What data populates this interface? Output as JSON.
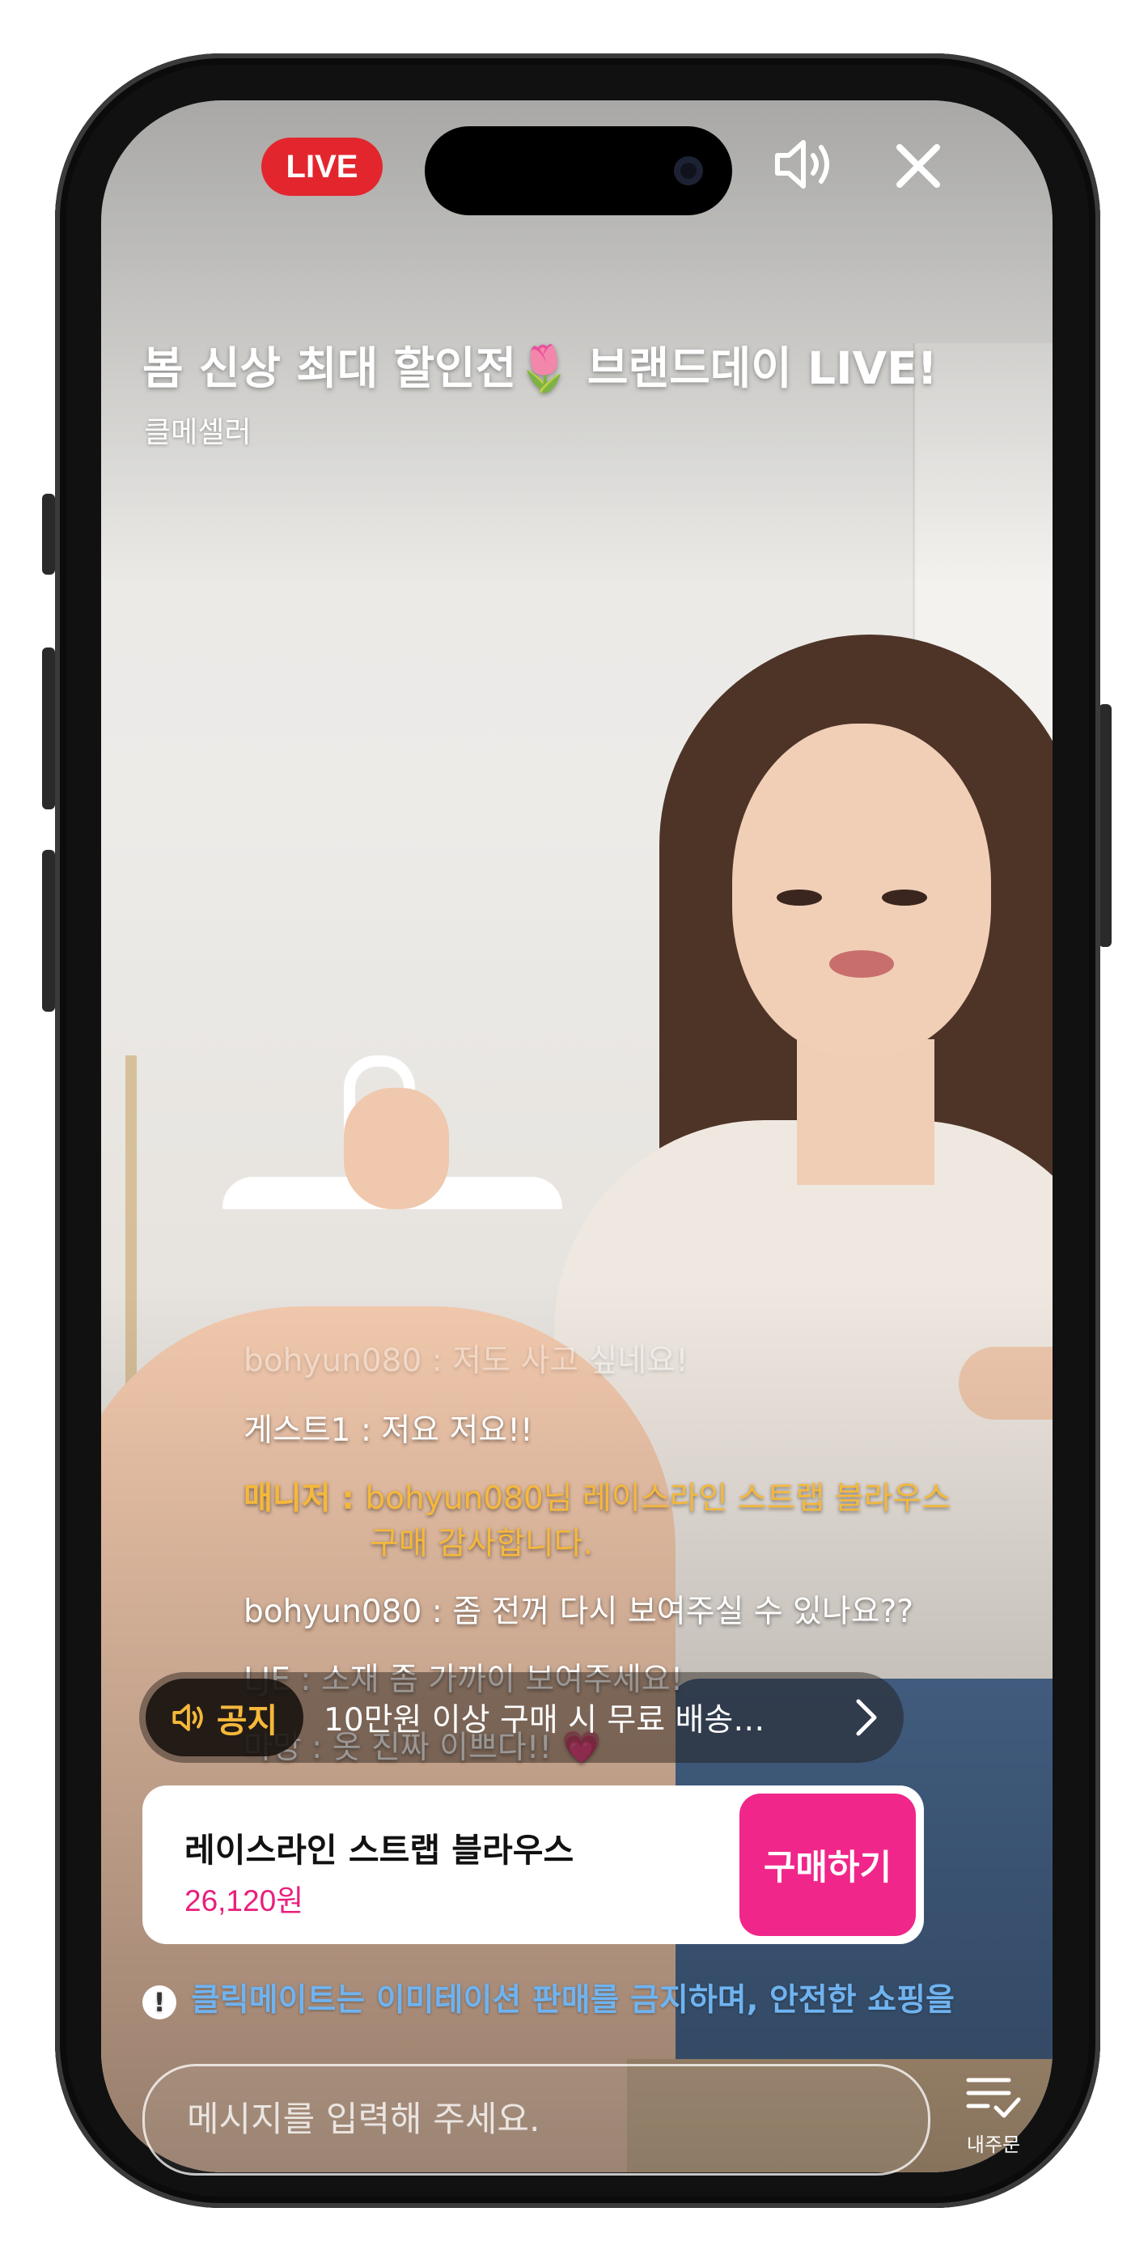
{
  "header": {
    "live_badge": "LIVE",
    "speaker_icon": "speaker-icon",
    "close_icon": "close-icon"
  },
  "broadcast": {
    "title": "봄 신상 최대 할인전🌷 브랜드데이 LIVE!",
    "seller": "클메셀러"
  },
  "chat": {
    "faded_message": "bohyun080 : 저도 사고 싶네요!",
    "messages": [
      {
        "user": "게스트1",
        "sep": " : ",
        "text": "저요 저요!!"
      },
      {
        "user": "매니저",
        "sep": " : ",
        "text": "bohyun080님 레이스라인 스트랩 블라우스",
        "cont": "구매 감사합니다.",
        "role": "manager"
      },
      {
        "user": "bohyun080",
        "sep": " : ",
        "text": "좀 전꺼 다시 보여주실 수 있나요??"
      },
      {
        "user": "LJE",
        "sep": " : ",
        "text": "소재 좀 가까이 보여주세요!"
      },
      {
        "user": "마망",
        "sep": " : ",
        "text": "옷 진짜 이쁘다!! 💗"
      }
    ]
  },
  "notice": {
    "tag": "공지",
    "text": "10만원 이상 구매 시 무료 배송…",
    "icon": "speaker-icon",
    "chevron": "chevron-right-icon"
  },
  "product": {
    "name": "레이스라인 스트랩 블라우스",
    "price": "26,120원",
    "buy_label": "구매하기"
  },
  "warning": {
    "text": "클릭메이트는 이미테이션 판매를 금지하며, 안전한 쇼핑을 위해"
  },
  "input": {
    "placeholder": "메시지를 입력해 주세요."
  },
  "orders": {
    "label": "내주문",
    "icon": "order-list-icon"
  },
  "colors": {
    "live_red": "#e3262d",
    "manager_yellow": "#f5b83b",
    "price_pink": "#e81f7c",
    "buy_button": "#f0268a",
    "warning_blue": "#6fb3f0"
  }
}
